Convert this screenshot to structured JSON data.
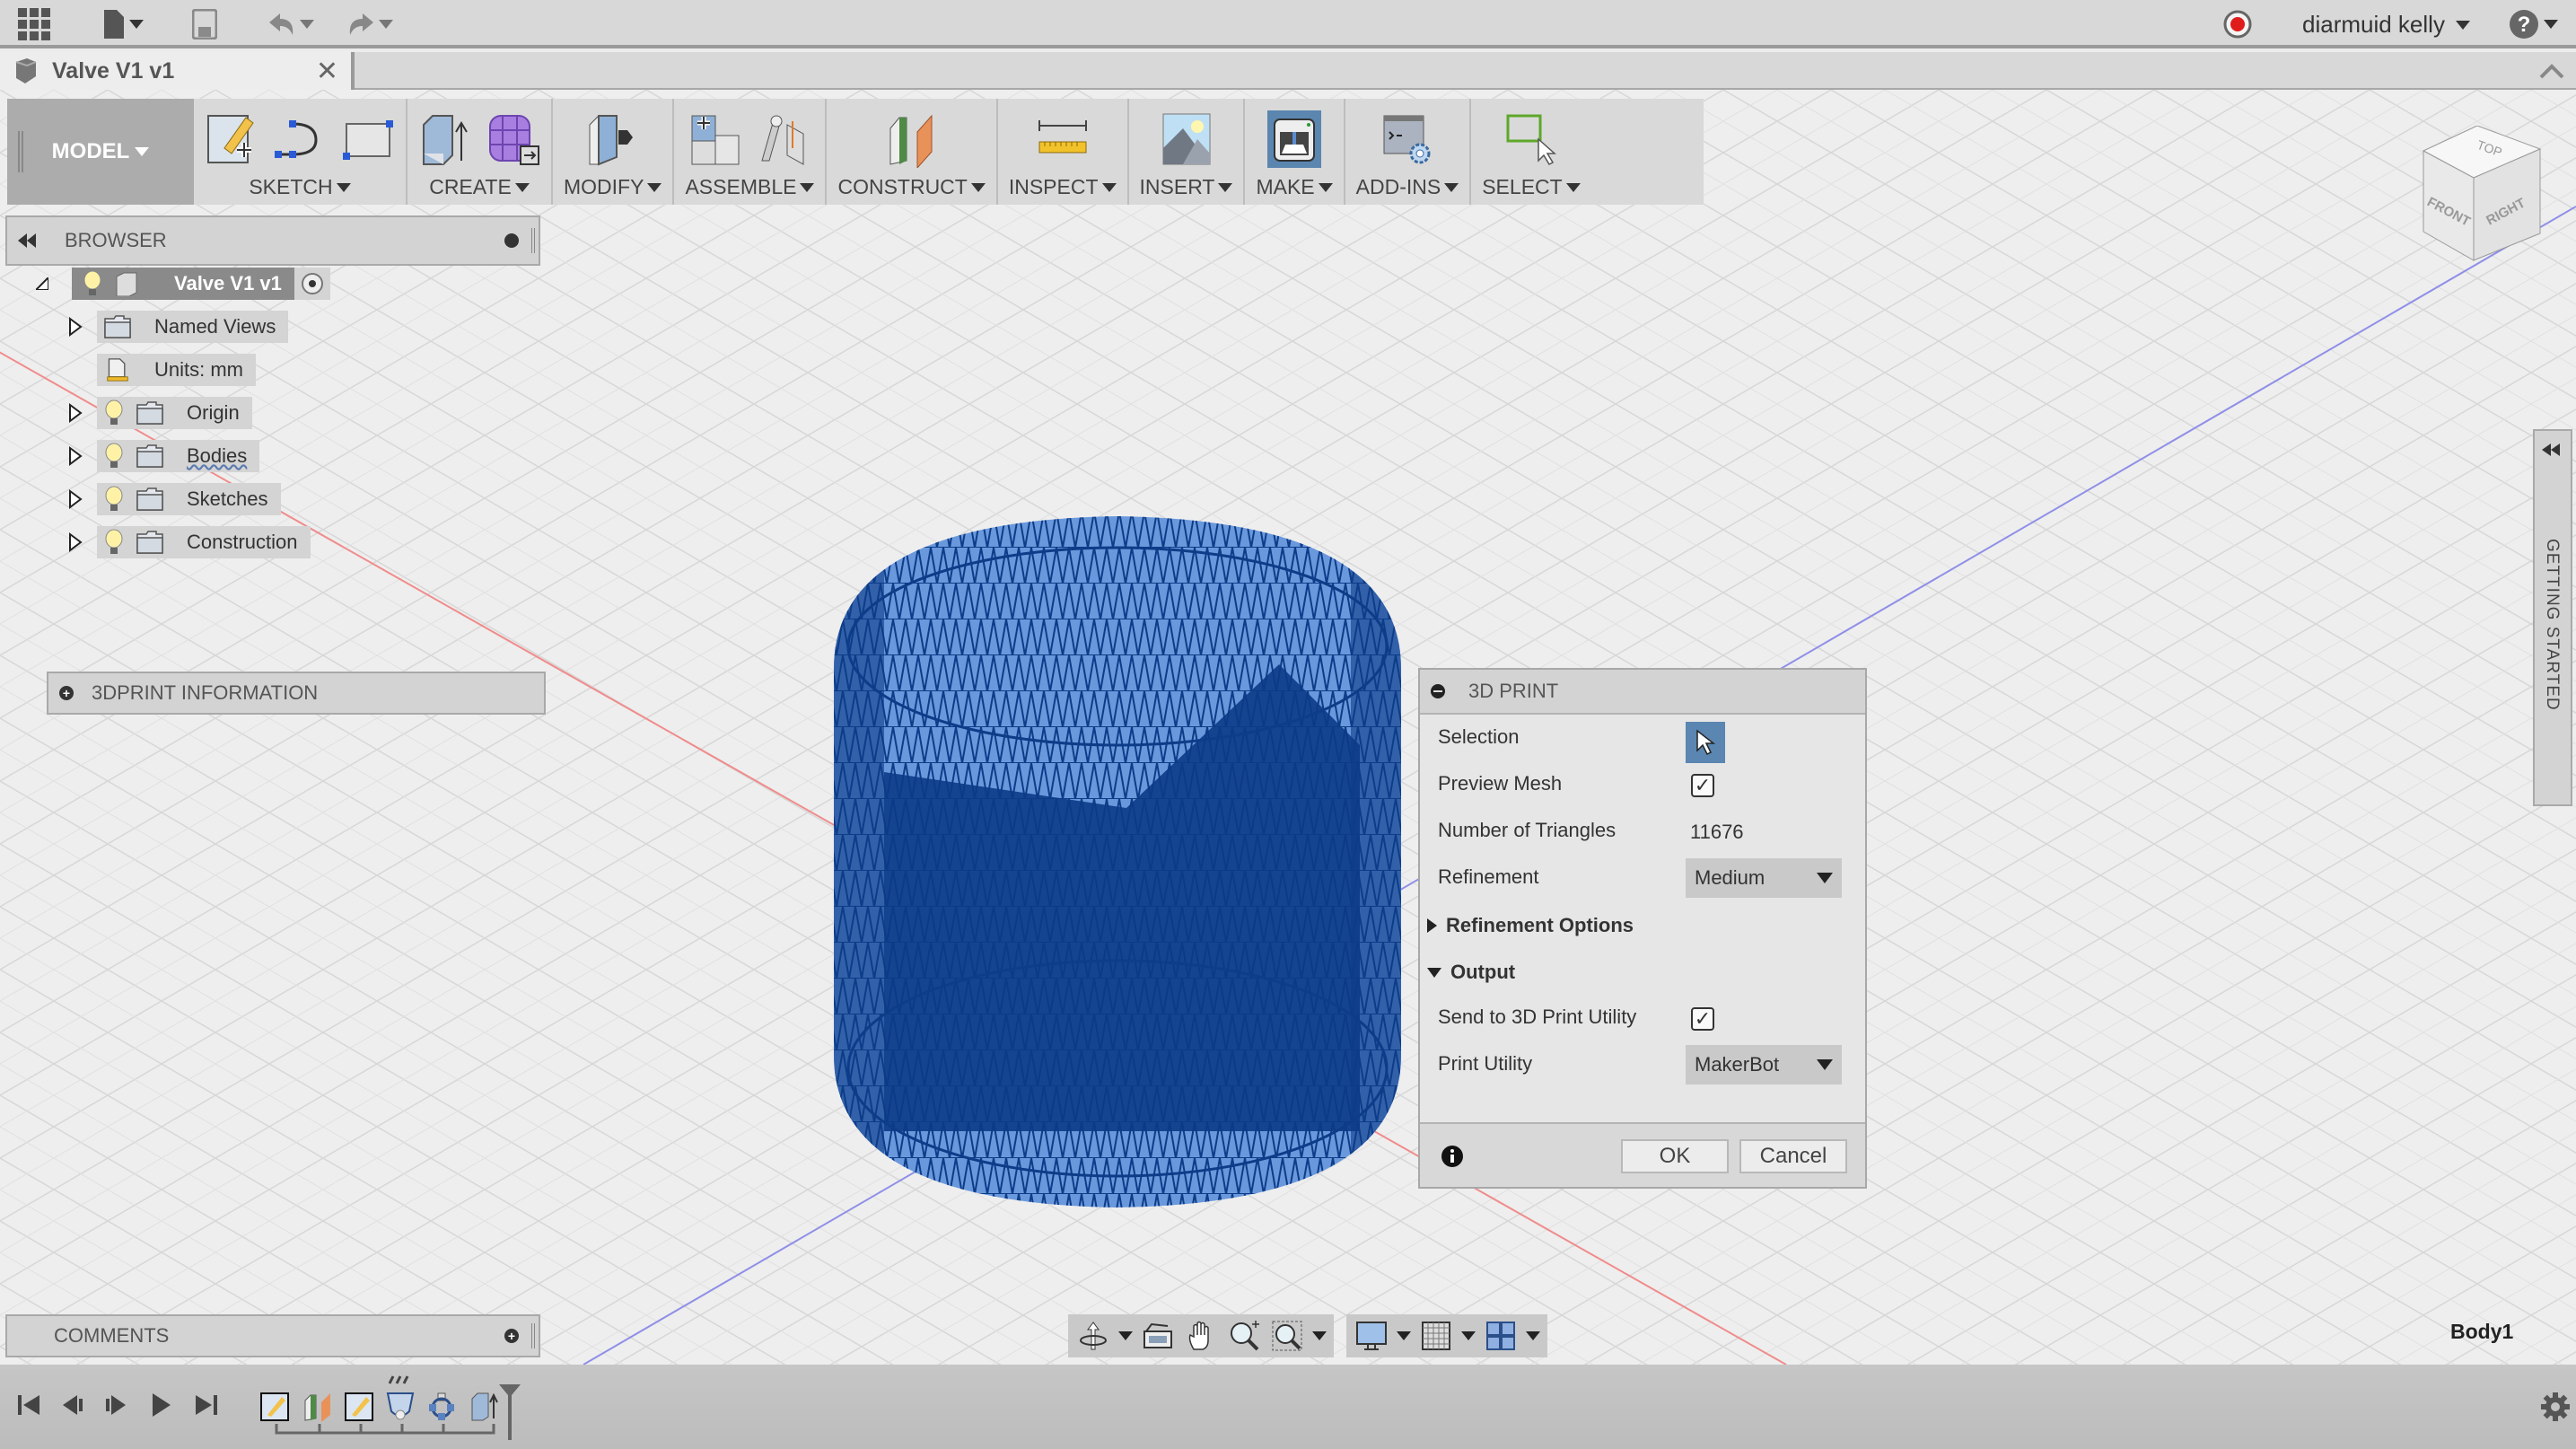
{
  "appbar": {
    "user_name": "diarmuid kelly",
    "icons": [
      "app-grid-icon",
      "file-icon",
      "save-icon",
      "undo-icon",
      "redo-icon",
      "record-icon",
      "help-icon"
    ]
  },
  "document_tab": {
    "title": "Valve V1 v1",
    "close": "✕"
  },
  "ribbon": {
    "workspace": "MODEL",
    "groups": [
      {
        "label": "SKETCH",
        "icons": [
          "create-sketch-icon",
          "arc-icon",
          "rectangle-icon"
        ]
      },
      {
        "label": "CREATE",
        "icons": [
          "extrude-icon",
          "create-form-icon"
        ]
      },
      {
        "label": "MODIFY",
        "icons": [
          "press-pull-icon"
        ]
      },
      {
        "label": "ASSEMBLE",
        "icons": [
          "new-component-icon",
          "joint-icon"
        ]
      },
      {
        "label": "CONSTRUCT",
        "icons": [
          "offset-plane-icon"
        ]
      },
      {
        "label": "INSPECT",
        "icons": [
          "measure-icon"
        ]
      },
      {
        "label": "INSERT",
        "icons": [
          "insert-image-icon"
        ]
      },
      {
        "label": "MAKE",
        "icons": [
          "3d-print-icon"
        ],
        "active": true
      },
      {
        "label": "ADD-INS",
        "icons": [
          "scripts-addins-icon"
        ]
      },
      {
        "label": "SELECT",
        "icons": [
          "select-icon"
        ]
      }
    ]
  },
  "browser": {
    "title": "BROWSER",
    "root": {
      "label": "Valve V1 v1"
    },
    "items": [
      {
        "label": "Named Views",
        "expandable": true,
        "bulb": false,
        "icon": "folder-icon"
      },
      {
        "label": "Units: mm",
        "expandable": false,
        "bulb": false,
        "icon": "units-document-icon"
      },
      {
        "label": "Origin",
        "expandable": true,
        "bulb": true,
        "icon": "folder-icon"
      },
      {
        "label": "Bodies",
        "expandable": true,
        "bulb": true,
        "icon": "folder-icon"
      },
      {
        "label": "Sketches",
        "expandable": true,
        "bulb": true,
        "icon": "folder-icon"
      },
      {
        "label": "Construction",
        "expandable": true,
        "bulb": true,
        "icon": "folder-icon"
      }
    ]
  },
  "print_info_panel": {
    "title": "3DPRINT INFORMATION"
  },
  "comments_panel": {
    "title": "COMMENTS"
  },
  "dialog": {
    "title": "3D PRINT",
    "selection_label": "Selection",
    "preview_mesh_label": "Preview Mesh",
    "preview_mesh_checked": true,
    "triangles_label": "Number of Triangles",
    "triangles_value": "11676",
    "refinement_label": "Refinement",
    "refinement_value": "Medium",
    "refinement_options_label": "Refinement Options",
    "output_label": "Output",
    "send_label": "Send to 3D Print Utility",
    "send_checked": true,
    "print_utility_label": "Print Utility",
    "print_utility_value": "MakerBot",
    "ok_label": "OK",
    "cancel_label": "Cancel",
    "check_glyph": "✓"
  },
  "viewcube": {
    "top": "TOP",
    "front": "FRONT",
    "right": "RIGHT"
  },
  "getting_started": {
    "label": "GETTING STARTED"
  },
  "selection_readout": "Body1",
  "nav_toolbar": {
    "icons": [
      "orbit-icon",
      "look-at-icon",
      "pan-icon",
      "zoom-icon",
      "fit-icon",
      "display-settings-icon",
      "grid-settings-icon",
      "viewports-icon"
    ]
  },
  "timeline": {
    "controls": [
      "first-step-icon",
      "previous-step-icon",
      "next-step-icon",
      "play-icon",
      "last-step-icon"
    ],
    "features": [
      "sketch-feature-icon",
      "plane-feature-icon",
      "sketch-feature-icon",
      "loft-feature-icon",
      "pattern-feature-icon",
      "extrude-feature-icon"
    ]
  },
  "colors": {
    "accent_blue": "#5a86b1",
    "mesh_fill": "#6a98dc",
    "mesh_wire": "#0b3a86",
    "record_red": "#e01b1b",
    "x_axis": "#f08c8c",
    "z_axis": "#8f8fe8"
  }
}
